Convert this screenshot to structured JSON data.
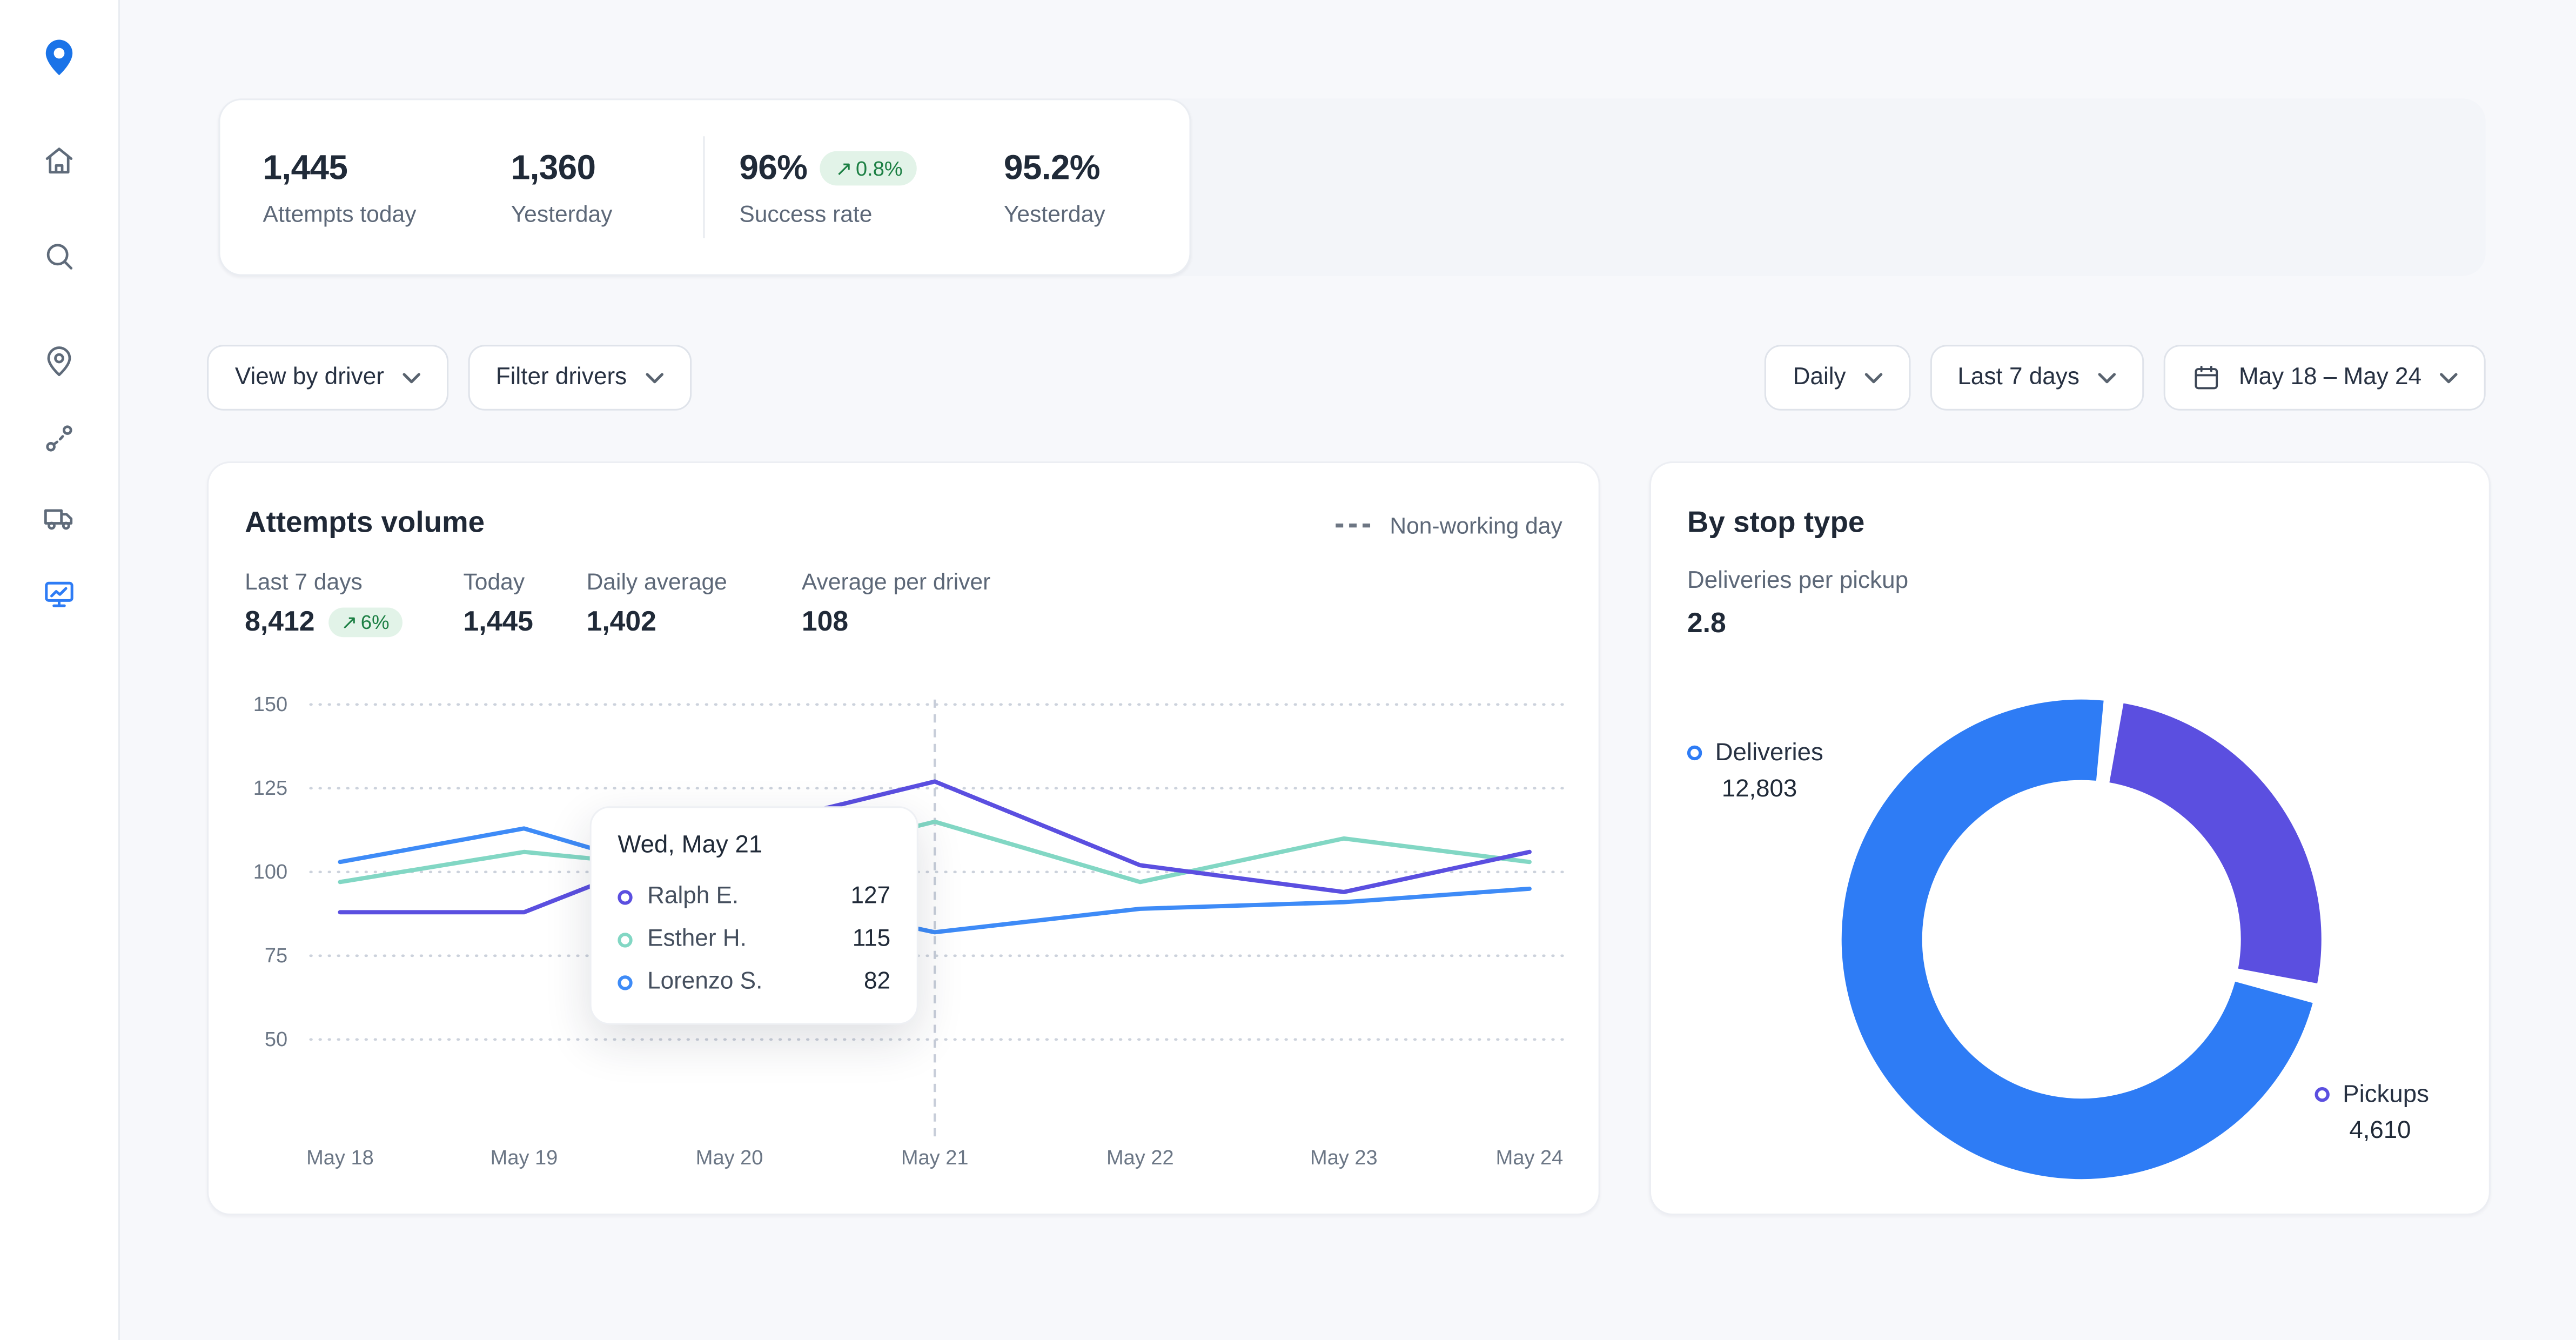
{
  "page": {
    "background": "#f7f8fb",
    "accent_blue": "#2e7cf5",
    "accent_violet": "#5b4fe0",
    "accent_teal": "#82d7c4",
    "positive_green": "#1b7f43"
  },
  "sidebar": {
    "logo_icon": "map-pin-logo",
    "items": [
      {
        "icon": "home-icon",
        "active": false
      },
      {
        "icon": "search-icon",
        "active": false
      },
      {
        "icon": "location-pin-icon",
        "active": false
      },
      {
        "icon": "route-icon",
        "active": false
      },
      {
        "icon": "truck-icon",
        "active": false
      },
      {
        "icon": "analytics-monitor-icon",
        "active": true
      }
    ]
  },
  "summary": {
    "attempts_today": {
      "value": "1,445",
      "label": "Attempts today"
    },
    "yesterday_attempts": {
      "value": "1,360",
      "label": "Yesterday"
    },
    "success_rate": {
      "value": "96%",
      "delta_arrow": "↗",
      "delta": "0.8%",
      "label": "Success rate"
    },
    "yesterday_success": {
      "value": "95.2%",
      "label": "Yesterday"
    }
  },
  "filters": {
    "view_by_driver": "View by driver",
    "filter_drivers": "Filter drivers",
    "granularity": "Daily",
    "range_preset": "Last 7 days",
    "date_range": "May 18 – May 24"
  },
  "attempts_card": {
    "title": "Attempts volume",
    "non_working_legend": "Non-working day",
    "stats": [
      {
        "label": "Last 7 days",
        "value": "8,412",
        "delta_arrow": "↗",
        "delta": "6%"
      },
      {
        "label": "Today",
        "value": "1,445"
      },
      {
        "label": "Daily average",
        "value": "1,402"
      },
      {
        "label": "Average per driver",
        "value": "108"
      }
    ],
    "tooltip": {
      "title": "Wed, May 21",
      "rows": [
        {
          "name": "Ralph E.",
          "value": "127",
          "color": "#5b4fe0"
        },
        {
          "name": "Esther H.",
          "value": "115",
          "color": "#82d7c4"
        },
        {
          "name": "Lorenzo S.",
          "value": "82",
          "color": "#3e8bf7"
        }
      ]
    }
  },
  "stop_type_card": {
    "title": "By stop type",
    "metric_label": "Deliveries per pickup",
    "metric_value": "2.8",
    "legend": [
      {
        "label": "Deliveries",
        "value": "12,803",
        "color": "#2e7cf5"
      },
      {
        "label": "Pickups",
        "value": "4,610",
        "color": "#5b4fe0"
      }
    ]
  },
  "chart_data": [
    {
      "type": "line",
      "title": "Attempts volume",
      "x": [
        "May 18",
        "May 19",
        "May 20",
        "May 21",
        "May 22",
        "May 23",
        "May 24"
      ],
      "series": [
        {
          "name": "Ralph E.",
          "color": "#5b4fe0",
          "values": [
            88,
            88,
            112,
            127,
            102,
            94,
            106
          ]
        },
        {
          "name": "Esther H.",
          "color": "#82d7c4",
          "values": [
            97,
            106,
            100,
            115,
            97,
            110,
            103
          ]
        },
        {
          "name": "Lorenzo S.",
          "color": "#3e8bf7",
          "values": [
            103,
            113,
            95,
            82,
            89,
            91,
            95
          ]
        }
      ],
      "yticks": [
        50,
        75,
        100,
        125,
        150
      ],
      "ylim": [
        40,
        160
      ],
      "xlabel": "",
      "ylabel": "",
      "grid": "dotted-horizontal",
      "hover_x": "May 21",
      "legend": [
        "Non-working day"
      ],
      "legend_position": "top-right"
    },
    {
      "type": "pie",
      "donut": true,
      "title": "By stop type",
      "slices": [
        {
          "label": "Deliveries",
          "value": 12803,
          "color": "#2e7cf5"
        },
        {
          "label": "Pickups",
          "value": 4610,
          "color": "#5b4fe0"
        }
      ],
      "start_angle": 103
    }
  ]
}
